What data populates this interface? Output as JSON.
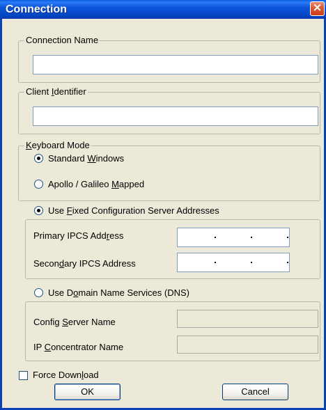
{
  "window": {
    "title": "Connection",
    "close_glyph": "×"
  },
  "connection_name": {
    "label": "Connection Name",
    "value": ""
  },
  "client_identifier": {
    "label_pre": "Client ",
    "label_key": "I",
    "label_post": "dentifier",
    "value": ""
  },
  "keyboard_mode": {
    "label_pre": "",
    "label_key": "K",
    "label_post": "eyboard Mode",
    "options": [
      {
        "pre": "Standard ",
        "key": "W",
        "post": "indows",
        "selected": true
      },
      {
        "pre": "Apollo / Galileo ",
        "key": "M",
        "post": "apped",
        "selected": false
      }
    ]
  },
  "fixed_servers": {
    "option_pre": "Use ",
    "option_key": "F",
    "option_post": "ixed Configuration Server Addresses",
    "selected": true,
    "primary": {
      "pre": "Primary IPCS Add",
      "key": "r",
      "post": "ess",
      "value": ". . ."
    },
    "secondary": {
      "pre": "Secon",
      "key": "d",
      "post": "ary IPCS Address",
      "value": ". . ."
    }
  },
  "dns": {
    "option_pre": "Use D",
    "option_key": "o",
    "option_post": "main Name Services (DNS)",
    "selected": false,
    "config_server": {
      "pre": "Config ",
      "key": "S",
      "post": "erver Name",
      "value": ""
    },
    "ip_concentrator": {
      "pre": "IP ",
      "key": "C",
      "post": "oncentrator  Name",
      "value": ""
    }
  },
  "force_download": {
    "pre": "Force Down",
    "key": "l",
    "post": "oad",
    "checked": false
  },
  "buttons": {
    "ok": "OK",
    "cancel": "Cancel"
  },
  "colors": {
    "titlebar": "#0b56da",
    "dialog_bg": "#ece9d8",
    "close": "#d8542f"
  }
}
